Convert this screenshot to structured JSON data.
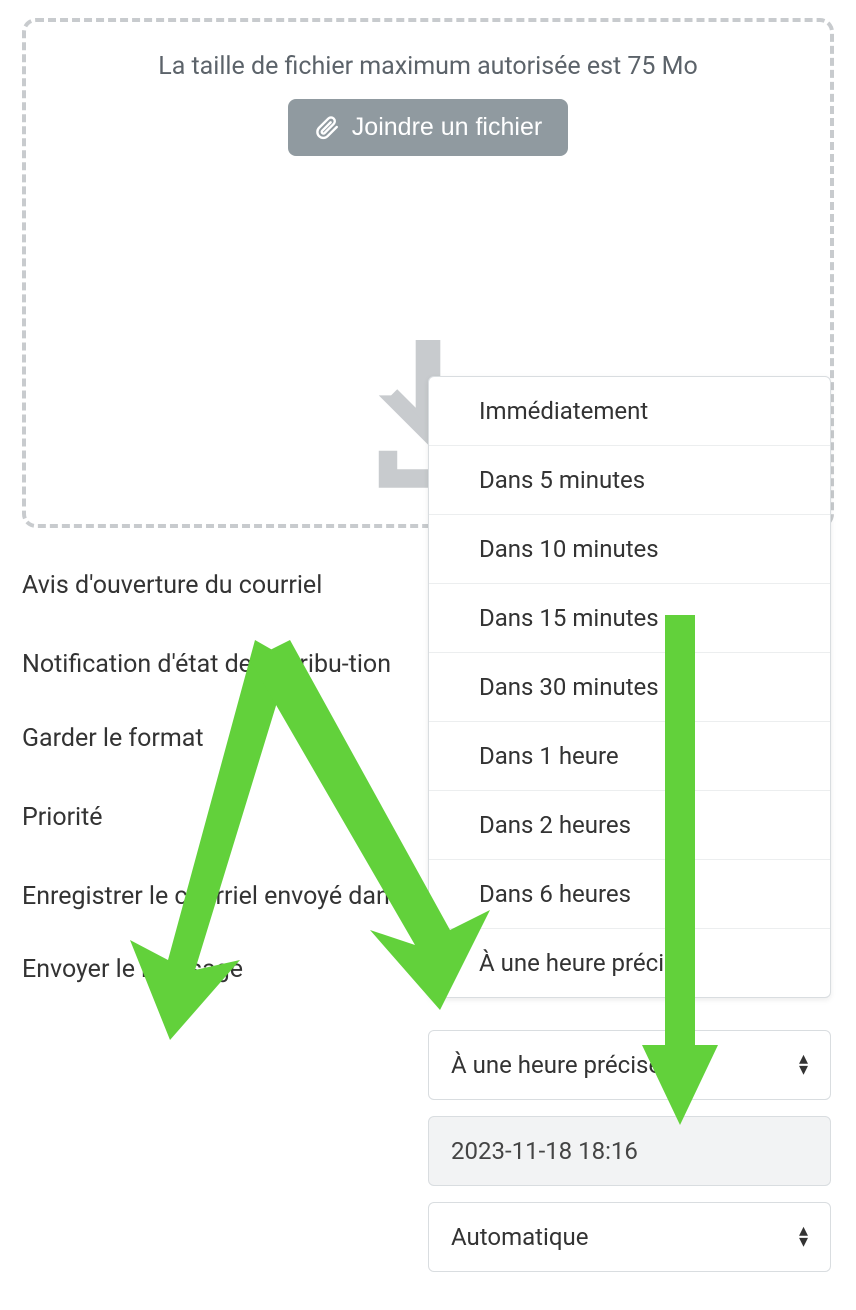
{
  "dropzone": {
    "max_size_text": "La taille de fichier maximum autorisée est 75 Mo",
    "attach_label": "Joindre un fichier"
  },
  "labels": {
    "read_receipt": "Avis d'ouverture du courriel",
    "delivery_status": "Notification d'état de distribu-tion",
    "keep_format": "Garder le format",
    "priority": "Priorité",
    "save_sent_in": "Enregistrer le courriel envoyé dans",
    "send_message": "Envoyer le message"
  },
  "send_time_options": [
    "Immédiatement",
    "Dans 5 minutes",
    "Dans 10 minutes",
    "Dans 15 minutes",
    "Dans 30 minutes",
    "Dans 1 heure",
    "Dans 2 heures",
    "Dans 6 heures",
    "À une heure précise"
  ],
  "send_time_selected": "À une heure précise",
  "send_time_select_value": "À une heure précise",
  "datetime_value": "2023-11-18 18:16",
  "format_select_value": "Automatique",
  "annotation_color": "#62d13b"
}
